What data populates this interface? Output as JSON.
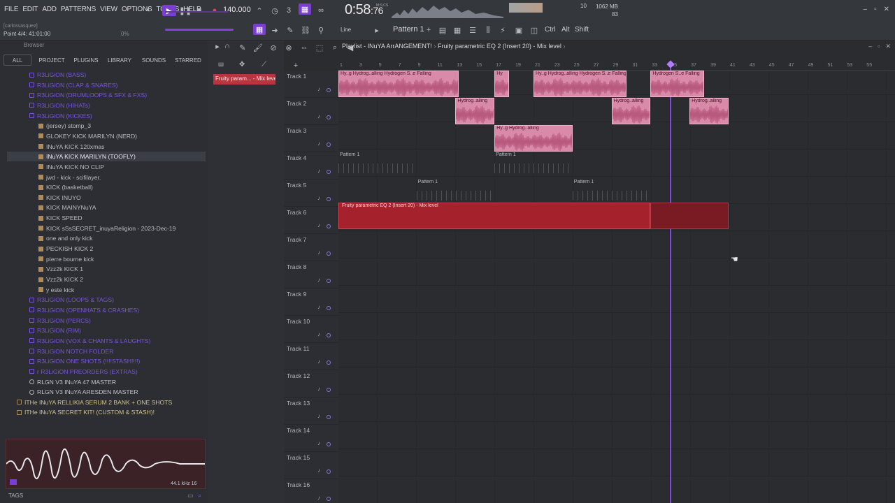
{
  "menu": [
    "FILE",
    "EDIT",
    "ADD",
    "PATTERNS",
    "VIEW",
    "OPTIONS",
    "TOOLS",
    "HELP"
  ],
  "hint": {
    "user": "[carlosvasquez]",
    "position": "Point 4/4: 41:01:00",
    "percent": "0%"
  },
  "transport": {
    "tempo": "140.000",
    "time": "0:58",
    "time_frac": ":76",
    "time_unit": "M:S:CS"
  },
  "stats": {
    "cpu": "10",
    "mem": "1062 MB",
    "mem2": "83"
  },
  "pattern": {
    "selected": "Pattern 1",
    "snap": "Line",
    "keys": [
      "Ctrl",
      "Alt",
      "Shift"
    ]
  },
  "browser": {
    "title": "Browser",
    "tabs": [
      "ALL",
      "PROJECT",
      "PLUGINS",
      "LIBRARY",
      "SOUNDS",
      "STARRED"
    ],
    "tree": [
      {
        "t": "folder",
        "label": "R3LiGiON (BASS)",
        "indent": 0
      },
      {
        "t": "folder",
        "label": "R3LiGiON (CLAP & SNARES)",
        "indent": 0
      },
      {
        "t": "folder",
        "label": "R3LiGiON (DRUMLOOPS & SFX & FXS)",
        "indent": 0
      },
      {
        "t": "folder",
        "label": "R3LiGiON (HIHATs)",
        "indent": 0
      },
      {
        "t": "folder",
        "label": "R3LiGiON (KICKES)",
        "indent": 0
      },
      {
        "t": "file",
        "label": "(jersey) stomp_3",
        "indent": 1
      },
      {
        "t": "file",
        "label": "GLOKEY KICK MARILYN (NERD)",
        "indent": 1
      },
      {
        "t": "file",
        "label": "INuYA KICK 120xmas",
        "indent": 1
      },
      {
        "t": "sel",
        "label": "INuYA KICK MARILYN (TOOFLY)",
        "indent": 1
      },
      {
        "t": "file",
        "label": "INuYA KICK NO CLIP",
        "indent": 1
      },
      {
        "t": "file",
        "label": "jwd - kick - scifilayer.",
        "indent": 1
      },
      {
        "t": "file",
        "label": "KICK (basketball)",
        "indent": 1
      },
      {
        "t": "file",
        "label": "KICK INUYO",
        "indent": 1
      },
      {
        "t": "file",
        "label": "KICK MAINYNuYA",
        "indent": 1
      },
      {
        "t": "file",
        "label": "KICK SPEED",
        "indent": 1
      },
      {
        "t": "file",
        "label": "KICK sSsSECRET_inuyaReligion - 2023-Dec-19",
        "indent": 1
      },
      {
        "t": "file",
        "label": "one and only kick",
        "indent": 1
      },
      {
        "t": "file",
        "label": "PECKISH KICK 2",
        "indent": 1
      },
      {
        "t": "file",
        "label": "pierre bourne kick",
        "indent": 1
      },
      {
        "t": "file",
        "label": "Vzz2k KICK 1",
        "indent": 1
      },
      {
        "t": "file",
        "label": "Vzz2k KICK 2",
        "indent": 1
      },
      {
        "t": "file",
        "label": "y este kick",
        "indent": 1
      },
      {
        "t": "folder",
        "label": "R3LiGiON (LOOPS & TAGS)",
        "indent": 0
      },
      {
        "t": "folder",
        "label": "R3LiGiON (OPENHATS & CRASHES)",
        "indent": 0
      },
      {
        "t": "folder",
        "label": "R3LiGiON (PERCS)",
        "indent": 0
      },
      {
        "t": "folder",
        "label": "R3LiGiON (RIM)",
        "indent": 0
      },
      {
        "t": "folder",
        "label": "R3LiGiON (VOX & CHANTS & LAUGHTS)",
        "indent": 0
      },
      {
        "t": "folder",
        "label": "R3LiGiON NOTCH FOLDER",
        "indent": 0
      },
      {
        "t": "folder",
        "label": "R3LiGiON ONE SHOTS (!!!!STASH!!!!)",
        "indent": 0
      },
      {
        "t": "folder",
        "label": "r R3LiGiON PREORDERS (EXTRAS)",
        "indent": 0
      },
      {
        "t": "master",
        "label": "RLGN V3 INuYA 47 MASTER",
        "indent": 0
      },
      {
        "t": "master",
        "label": "RLGN V3 INuYA ARESDEN MASTER",
        "indent": 0
      },
      {
        "t": "pack",
        "label": "ITHe INuYA RELLIKIA SERUM 2 BANK + ONE SHOTS",
        "indent": -1
      },
      {
        "t": "pack",
        "label": "ITHe INuYA SECRET KIT! (CUSTOM & STASH)!",
        "indent": -1
      }
    ],
    "preview_info": "44.1 kHz 16",
    "tags": "TAGS"
  },
  "fx_chip": "Fruity param... - Mix level",
  "playlist": {
    "title": "Playlist - INuYA ArrANGEMENT!",
    "sep": "›",
    "subtitle": "Fruity parametric EQ 2 (Insert 20) - Mix level",
    "ruler": [
      "1",
      "3",
      "5",
      "7",
      "9",
      "11",
      "13",
      "15",
      "17",
      "19",
      "21",
      "23",
      "25",
      "27",
      "29",
      "31",
      "33",
      "35",
      "37",
      "39",
      "41",
      "43",
      "45",
      "47",
      "49",
      "51",
      "53",
      "55"
    ],
    "tracks": [
      "Track 1",
      "Track 2",
      "Track 3",
      "Track 4",
      "Track 5",
      "Track 6",
      "Track 7",
      "Track 8",
      "Track 9",
      "Track 10",
      "Track 11",
      "Track 12",
      "Track 13",
      "Track 14",
      "Track 15",
      "Track 16"
    ],
    "audio_clips": [
      {
        "track": 0,
        "start": 1,
        "end": 13.3,
        "label": "Hy..g  Hydrog..alling  Hydrogen S..e Falling"
      },
      {
        "track": 0,
        "start": 17,
        "end": 18.5,
        "label": "Hy"
      },
      {
        "track": 0,
        "start": 21,
        "end": 30.5,
        "label": "Hy..g  Hydrog..alling  Hydrogen S..e Falling"
      },
      {
        "track": 0,
        "start": 33,
        "end": 38.5,
        "label": "Hydrogen S..e Falling"
      },
      {
        "track": 1,
        "start": 13,
        "end": 17,
        "label": "Hydrog..alling"
      },
      {
        "track": 1,
        "start": 29,
        "end": 33,
        "label": "Hydrog..alling"
      },
      {
        "track": 1,
        "start": 37,
        "end": 41,
        "label": "Hydrog..alling"
      },
      {
        "track": 2,
        "start": 17,
        "end": 25,
        "label": "Hy..g  Hydrog..alling"
      }
    ],
    "pattern_clips": [
      {
        "track": 3,
        "start": 1,
        "end": 9,
        "label": "Pattern 1"
      },
      {
        "track": 3,
        "start": 17,
        "end": 25,
        "label": "Pattern 1"
      },
      {
        "track": 4,
        "start": 9,
        "end": 17,
        "label": "Pattern 1"
      },
      {
        "track": 4,
        "start": 25,
        "end": 33,
        "label": "Pattern 1"
      }
    ],
    "automation": {
      "track": 5,
      "start": 1,
      "end": 33,
      "tail_end": 41,
      "label": "Fruity parametric EQ 2 (Insert 20) - Mix level"
    },
    "playhead_bar": 35
  }
}
